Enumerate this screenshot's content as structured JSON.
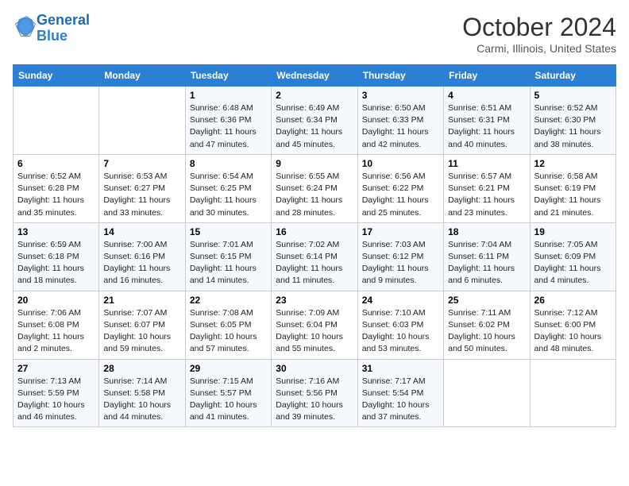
{
  "header": {
    "logo_line1": "General",
    "logo_line2": "Blue",
    "month_title": "October 2024",
    "location": "Carmi, Illinois, United States"
  },
  "days_of_week": [
    "Sunday",
    "Monday",
    "Tuesday",
    "Wednesday",
    "Thursday",
    "Friday",
    "Saturday"
  ],
  "weeks": [
    [
      {
        "day": "",
        "info": ""
      },
      {
        "day": "",
        "info": ""
      },
      {
        "day": "1",
        "info": "Sunrise: 6:48 AM\nSunset: 6:36 PM\nDaylight: 11 hours and 47 minutes."
      },
      {
        "day": "2",
        "info": "Sunrise: 6:49 AM\nSunset: 6:34 PM\nDaylight: 11 hours and 45 minutes."
      },
      {
        "day": "3",
        "info": "Sunrise: 6:50 AM\nSunset: 6:33 PM\nDaylight: 11 hours and 42 minutes."
      },
      {
        "day": "4",
        "info": "Sunrise: 6:51 AM\nSunset: 6:31 PM\nDaylight: 11 hours and 40 minutes."
      },
      {
        "day": "5",
        "info": "Sunrise: 6:52 AM\nSunset: 6:30 PM\nDaylight: 11 hours and 38 minutes."
      }
    ],
    [
      {
        "day": "6",
        "info": "Sunrise: 6:52 AM\nSunset: 6:28 PM\nDaylight: 11 hours and 35 minutes."
      },
      {
        "day": "7",
        "info": "Sunrise: 6:53 AM\nSunset: 6:27 PM\nDaylight: 11 hours and 33 minutes."
      },
      {
        "day": "8",
        "info": "Sunrise: 6:54 AM\nSunset: 6:25 PM\nDaylight: 11 hours and 30 minutes."
      },
      {
        "day": "9",
        "info": "Sunrise: 6:55 AM\nSunset: 6:24 PM\nDaylight: 11 hours and 28 minutes."
      },
      {
        "day": "10",
        "info": "Sunrise: 6:56 AM\nSunset: 6:22 PM\nDaylight: 11 hours and 25 minutes."
      },
      {
        "day": "11",
        "info": "Sunrise: 6:57 AM\nSunset: 6:21 PM\nDaylight: 11 hours and 23 minutes."
      },
      {
        "day": "12",
        "info": "Sunrise: 6:58 AM\nSunset: 6:19 PM\nDaylight: 11 hours and 21 minutes."
      }
    ],
    [
      {
        "day": "13",
        "info": "Sunrise: 6:59 AM\nSunset: 6:18 PM\nDaylight: 11 hours and 18 minutes."
      },
      {
        "day": "14",
        "info": "Sunrise: 7:00 AM\nSunset: 6:16 PM\nDaylight: 11 hours and 16 minutes."
      },
      {
        "day": "15",
        "info": "Sunrise: 7:01 AM\nSunset: 6:15 PM\nDaylight: 11 hours and 14 minutes."
      },
      {
        "day": "16",
        "info": "Sunrise: 7:02 AM\nSunset: 6:14 PM\nDaylight: 11 hours and 11 minutes."
      },
      {
        "day": "17",
        "info": "Sunrise: 7:03 AM\nSunset: 6:12 PM\nDaylight: 11 hours and 9 minutes."
      },
      {
        "day": "18",
        "info": "Sunrise: 7:04 AM\nSunset: 6:11 PM\nDaylight: 11 hours and 6 minutes."
      },
      {
        "day": "19",
        "info": "Sunrise: 7:05 AM\nSunset: 6:09 PM\nDaylight: 11 hours and 4 minutes."
      }
    ],
    [
      {
        "day": "20",
        "info": "Sunrise: 7:06 AM\nSunset: 6:08 PM\nDaylight: 11 hours and 2 minutes."
      },
      {
        "day": "21",
        "info": "Sunrise: 7:07 AM\nSunset: 6:07 PM\nDaylight: 10 hours and 59 minutes."
      },
      {
        "day": "22",
        "info": "Sunrise: 7:08 AM\nSunset: 6:05 PM\nDaylight: 10 hours and 57 minutes."
      },
      {
        "day": "23",
        "info": "Sunrise: 7:09 AM\nSunset: 6:04 PM\nDaylight: 10 hours and 55 minutes."
      },
      {
        "day": "24",
        "info": "Sunrise: 7:10 AM\nSunset: 6:03 PM\nDaylight: 10 hours and 53 minutes."
      },
      {
        "day": "25",
        "info": "Sunrise: 7:11 AM\nSunset: 6:02 PM\nDaylight: 10 hours and 50 minutes."
      },
      {
        "day": "26",
        "info": "Sunrise: 7:12 AM\nSunset: 6:00 PM\nDaylight: 10 hours and 48 minutes."
      }
    ],
    [
      {
        "day": "27",
        "info": "Sunrise: 7:13 AM\nSunset: 5:59 PM\nDaylight: 10 hours and 46 minutes."
      },
      {
        "day": "28",
        "info": "Sunrise: 7:14 AM\nSunset: 5:58 PM\nDaylight: 10 hours and 44 minutes."
      },
      {
        "day": "29",
        "info": "Sunrise: 7:15 AM\nSunset: 5:57 PM\nDaylight: 10 hours and 41 minutes."
      },
      {
        "day": "30",
        "info": "Sunrise: 7:16 AM\nSunset: 5:56 PM\nDaylight: 10 hours and 39 minutes."
      },
      {
        "day": "31",
        "info": "Sunrise: 7:17 AM\nSunset: 5:54 PM\nDaylight: 10 hours and 37 minutes."
      },
      {
        "day": "",
        "info": ""
      },
      {
        "day": "",
        "info": ""
      }
    ]
  ]
}
